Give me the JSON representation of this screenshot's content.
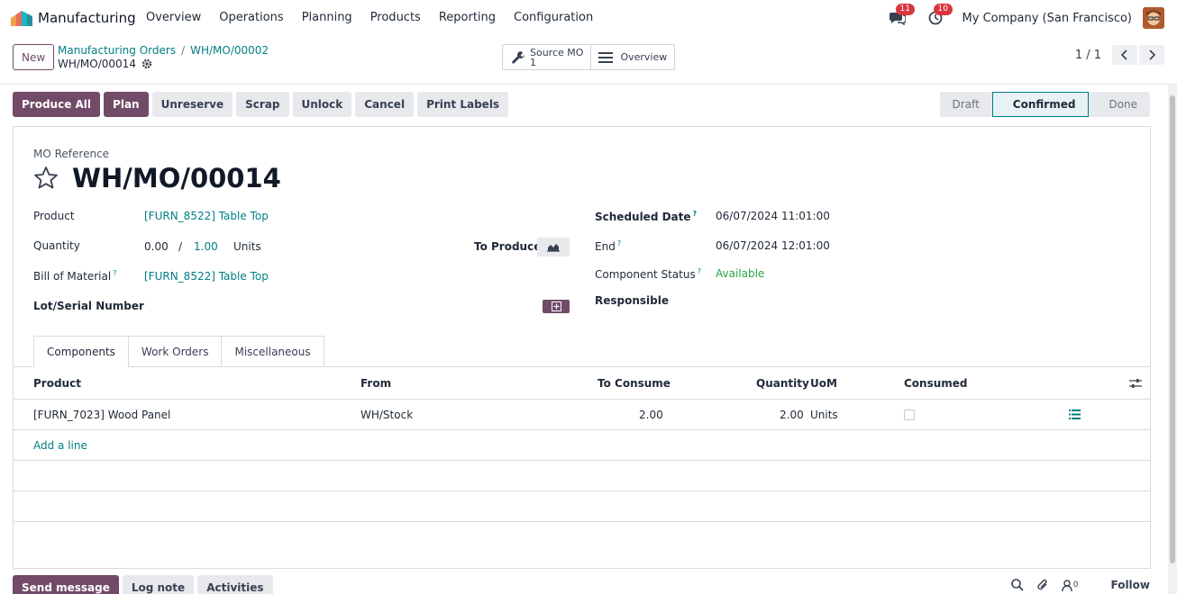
{
  "navbar": {
    "app_name": "Manufacturing",
    "menu": [
      "Overview",
      "Operations",
      "Planning",
      "Products",
      "Reporting",
      "Configuration"
    ],
    "messages_count": "11",
    "activities_count": "10",
    "company": "My Company (San Francisco)"
  },
  "control_panel": {
    "new_label": "New",
    "breadcrumb_parent": "Manufacturing Orders",
    "breadcrumb_sep": "/",
    "breadcrumb_mid": "WH/MO/00002",
    "record_name": "WH/MO/00014",
    "smart_source_label": "Source MO",
    "smart_source_count": "1",
    "smart_overview_label": "Overview",
    "pager": "1 / 1"
  },
  "actions": [
    "Produce All",
    "Plan",
    "Unreserve",
    "Scrap",
    "Unlock",
    "Cancel",
    "Print Labels"
  ],
  "statusbar": {
    "stages": [
      "Draft",
      "Confirmed",
      "Done"
    ],
    "active": "Confirmed"
  },
  "form": {
    "mo_ref_label": "MO Reference",
    "mo_ref": "WH/MO/00014",
    "product_label": "Product",
    "product_value": "[FURN_8522] Table Top",
    "quantity_label": "Quantity",
    "qty_produced": "0.00",
    "qty_slash": "/",
    "qty_target": "1.00",
    "qty_uom": "Units",
    "to_produce_label": "To Produce",
    "bom_label": "Bill of Material",
    "bom_value": "[FURN_8522] Table Top",
    "lot_label": "Lot/Serial Number",
    "scheduled_label": "Scheduled Date",
    "scheduled_value": "06/07/2024 11:01:00",
    "end_label": "End",
    "end_value": "06/07/2024 12:01:00",
    "component_status_label": "Component Status",
    "component_status_value": "Available",
    "responsible_label": "Responsible",
    "help_mark": "?"
  },
  "tabs": [
    "Components",
    "Work Orders",
    "Miscellaneous"
  ],
  "table": {
    "headers": [
      "Product",
      "From",
      "To Consume",
      "Quantity",
      "UoM",
      "Consumed"
    ],
    "rows": [
      {
        "product": "[FURN_7023] Wood Panel",
        "from": "WH/Stock",
        "to_consume": "2.00",
        "quantity": "2.00",
        "uom": "Units"
      }
    ],
    "add_line": "Add a line"
  },
  "chatter": {
    "buttons": [
      "Send message",
      "Log note",
      "Activities"
    ],
    "followers_count": "0",
    "follow_label": "Follow"
  },
  "colors": {
    "primary": "#714b67",
    "link": "#017e84",
    "badge": "#d9363e",
    "success": "#28a745"
  }
}
